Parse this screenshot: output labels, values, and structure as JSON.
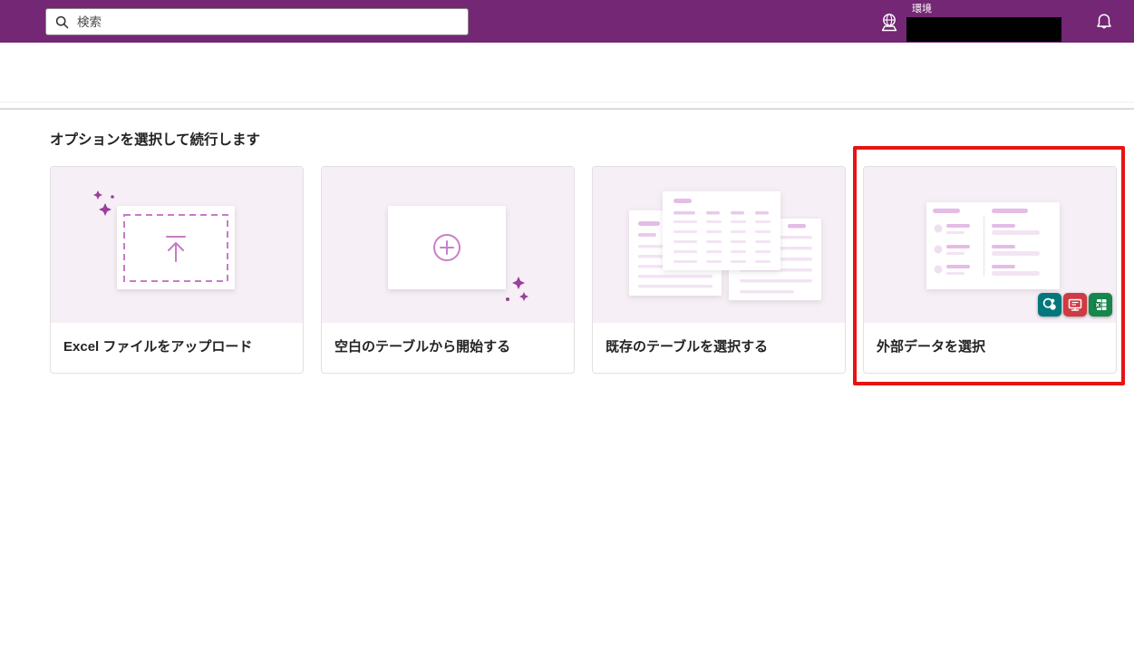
{
  "header": {
    "search_placeholder": "検索",
    "environment_label": "環境",
    "icons": {
      "search": "magnifier",
      "environment": "globe-on-stand",
      "notifications": "bell"
    },
    "colors": {
      "header_purple": "#742774"
    }
  },
  "page": {
    "heading": "オプションを選択して続行します",
    "cards": [
      {
        "label": "Excel ファイルをアップロード",
        "illustration": "upload-dashed-box-with-sparkles",
        "highlighted": false
      },
      {
        "label": "空白のテーブルから開始する",
        "illustration": "add-circle-with-sparkles",
        "highlighted": false
      },
      {
        "label": "既存のテーブルを選択する",
        "illustration": "stack-of-table-sheets",
        "highlighted": false
      },
      {
        "label": "外部データを選択",
        "illustration": "two-column-list-card",
        "highlighted": true,
        "badge_icons": [
          "sharepoint",
          "monitor-app",
          "excel-table"
        ]
      }
    ],
    "annotation": {
      "type": "highlight-box",
      "color": "#e81313",
      "target_card_label": "外部データを選択"
    }
  },
  "colors": {
    "accent_magenta": "#c77ac9",
    "sparkle_purple": "#9a3f9f",
    "illustration_bg": "#f6eff6",
    "line_strong": "#e4bce6",
    "line_light": "#f2e4f3",
    "badge_teal": "#03787c",
    "badge_red": "#cf3b44",
    "badge_green": "#15864c"
  }
}
